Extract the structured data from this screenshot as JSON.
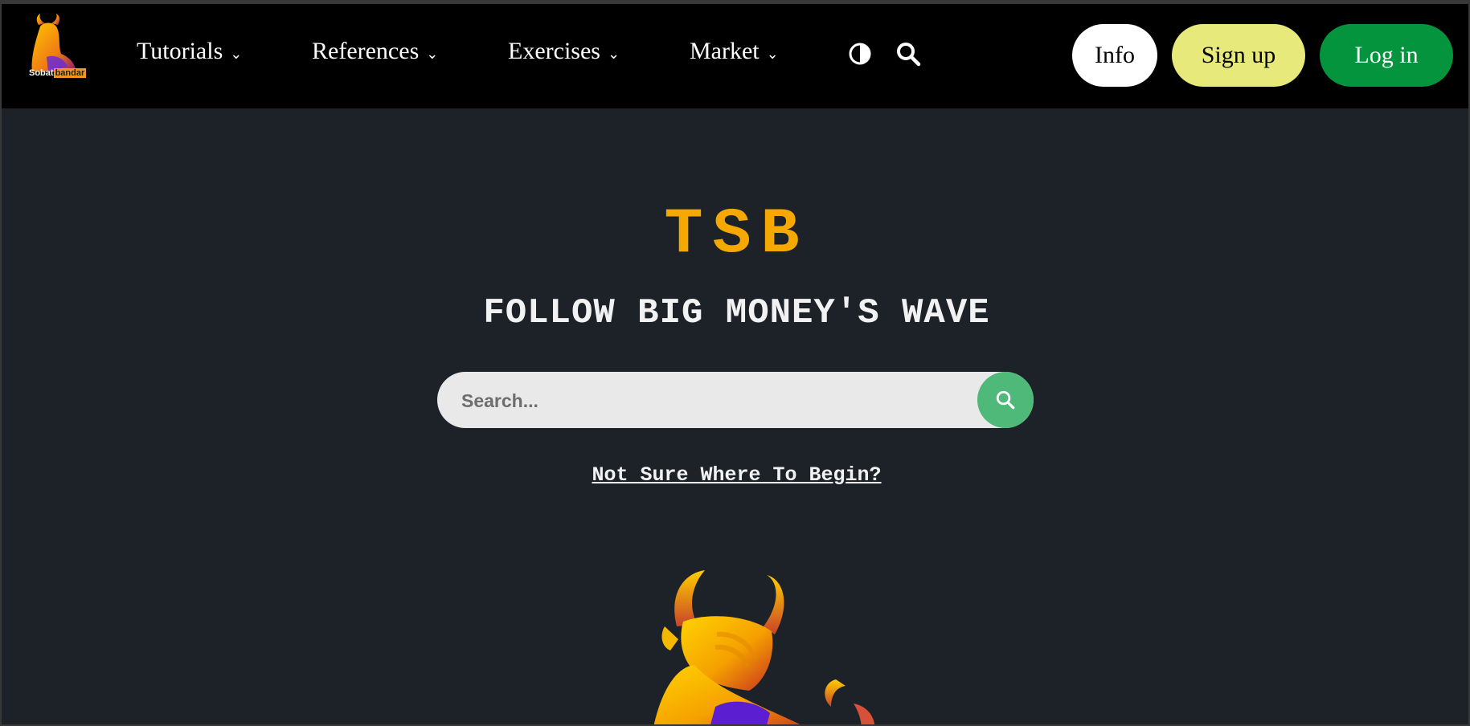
{
  "nav": {
    "logo": {
      "name": "Sobat",
      "accent": "bandar"
    },
    "items": [
      {
        "label": "Tutorials"
      },
      {
        "label": "References"
      },
      {
        "label": "Exercises"
      },
      {
        "label": "Market"
      }
    ],
    "icons": {
      "theme": "contrast-icon",
      "search": "search-icon",
      "chevron": "chevron-down-icon"
    },
    "buttons": {
      "info": "Info",
      "signup": "Sign up",
      "login": "Log in"
    }
  },
  "hero": {
    "title": "TSB",
    "subtitle": "FOLLOW BIG MONEY'S WAVE",
    "search": {
      "placeholder": "Search...",
      "value": ""
    },
    "begin_link": "Not Sure Where To Begin?"
  },
  "colors": {
    "page_bg": "#1d2228",
    "nav_bg": "#000000",
    "accent": "#f5a800",
    "signup": "#e7e97b",
    "login": "#04943d",
    "search_button": "#4fb979"
  }
}
